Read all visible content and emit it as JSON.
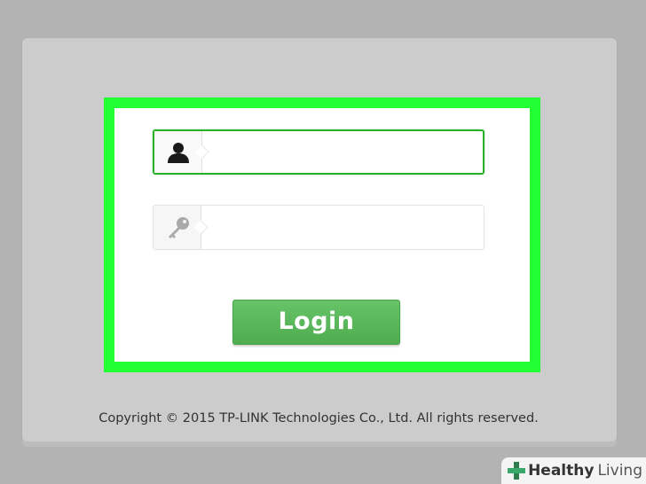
{
  "login_form": {
    "username": {
      "icon": "user-icon",
      "value": "",
      "placeholder": ""
    },
    "password": {
      "icon": "key-icon",
      "value": "",
      "placeholder": ""
    },
    "login_label": "Login"
  },
  "footer": {
    "copyright": "Copyright © 2015 TP-LINK Technologies Co., Ltd. All rights reserved."
  },
  "watermark": {
    "brand_bold": "Healthy",
    "brand_light": "Living"
  },
  "colors": {
    "highlight": "#22ff33",
    "accent": "#4fac4f",
    "focus_border": "#27b127"
  }
}
